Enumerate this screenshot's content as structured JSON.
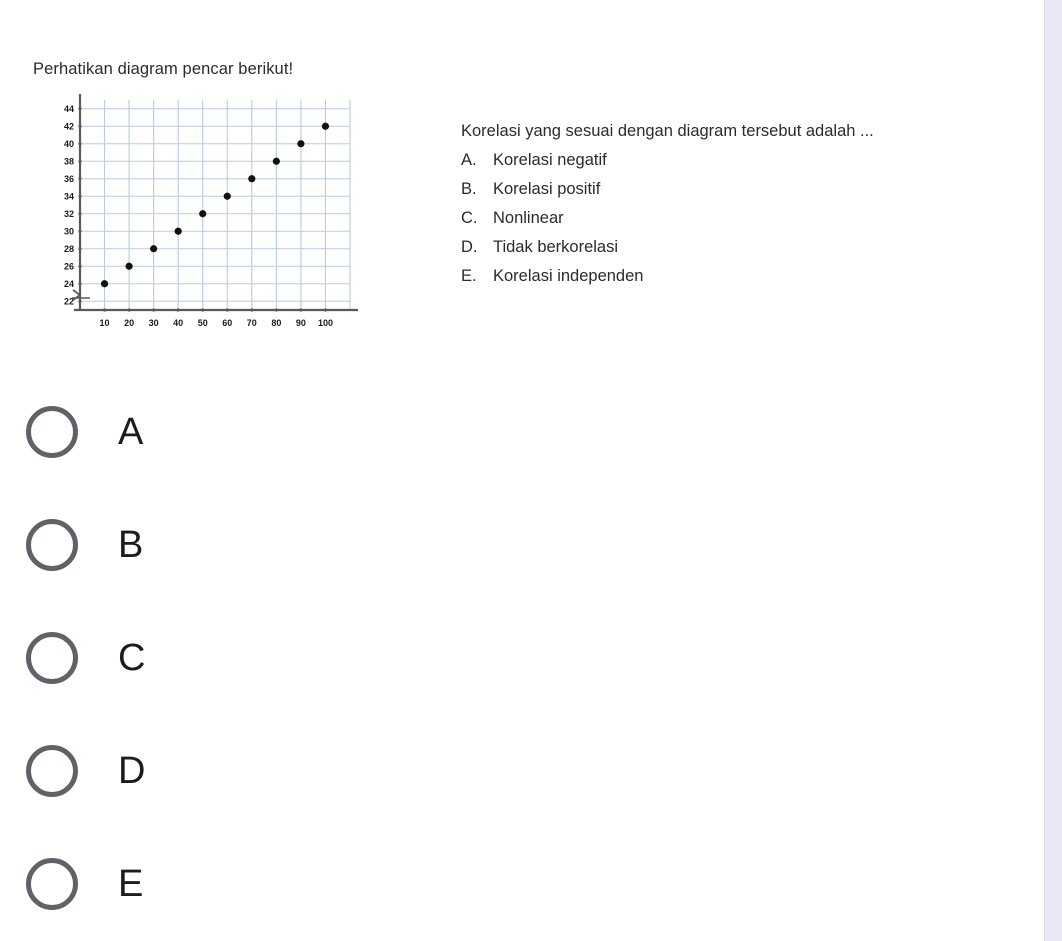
{
  "stimulus": {
    "title": "Perhatikan diagram pencar berikut!"
  },
  "question": {
    "stem": "Korelasi yang sesuai dengan diagram tersebut adalah ...",
    "options": [
      {
        "letter": "A.",
        "text": "Korelasi negatif"
      },
      {
        "letter": "B.",
        "text": "Korelasi positif"
      },
      {
        "letter": "C.",
        "text": "Nonlinear"
      },
      {
        "letter": "D.",
        "text": "Tidak berkorelasi"
      },
      {
        "letter": "E.",
        "text": "Korelasi independen"
      }
    ]
  },
  "answer_choices": [
    {
      "label": "A",
      "selected": false
    },
    {
      "label": "B",
      "selected": false
    },
    {
      "label": "C",
      "selected": false
    },
    {
      "label": "D",
      "selected": false
    },
    {
      "label": "E",
      "selected": false
    }
  ],
  "colors": {
    "grid": "#b8cce4",
    "axis": "#595959",
    "marker": "#111111",
    "panel": "#e9e8f4",
    "text": "#2b2b2b"
  },
  "chart_data": {
    "type": "scatter",
    "title": "",
    "xlabel": "",
    "ylabel": "",
    "x": [
      10,
      20,
      30,
      40,
      50,
      60,
      70,
      80,
      90,
      100
    ],
    "values": [
      24,
      26,
      28,
      30,
      32,
      34,
      36,
      38,
      40,
      42
    ],
    "points": [
      {
        "x": 10,
        "y": 24
      },
      {
        "x": 20,
        "y": 26
      },
      {
        "x": 30,
        "y": 28
      },
      {
        "x": 40,
        "y": 30
      },
      {
        "x": 50,
        "y": 32
      },
      {
        "x": 60,
        "y": 34
      },
      {
        "x": 70,
        "y": 36
      },
      {
        "x": 80,
        "y": 38
      },
      {
        "x": 90,
        "y": 40
      },
      {
        "x": 100,
        "y": 42
      }
    ],
    "xticks": [
      10,
      20,
      30,
      40,
      50,
      60,
      70,
      80,
      90,
      100
    ],
    "yticks": [
      22,
      24,
      26,
      28,
      30,
      32,
      34,
      36,
      38,
      40,
      42,
      44
    ],
    "xlim": [
      0,
      110
    ],
    "ylim": [
      21,
      45
    ],
    "grid": true,
    "legend": false,
    "axis_break": true
  }
}
